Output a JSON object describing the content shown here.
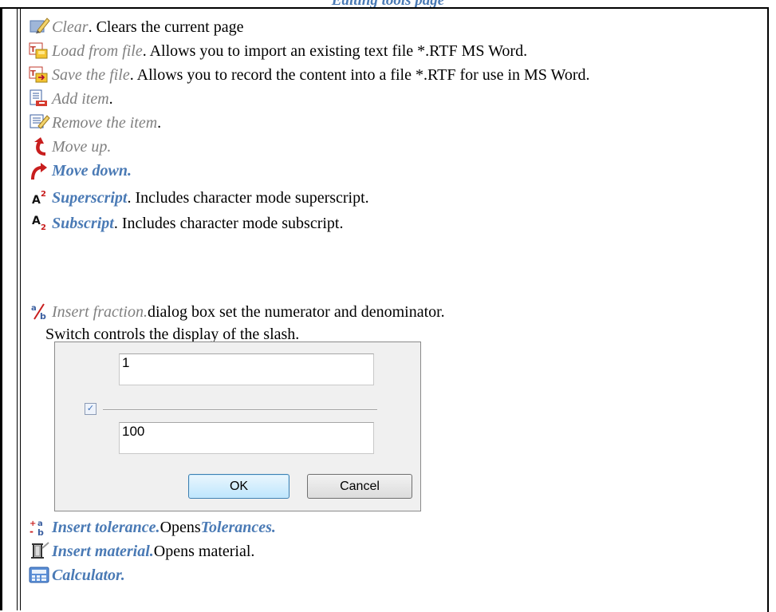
{
  "page": {
    "heading": "Editing tools page"
  },
  "items": [
    {
      "icon": "eraser-icon",
      "name": "Clear",
      "name_style": "gray",
      "text": ". Clears the current page"
    },
    {
      "icon": "load-file-icon",
      "name": "Load from file",
      "name_style": "gray",
      "text": ". Allows you to import an existing text file *.RTF MS Word."
    },
    {
      "icon": "save-file-icon",
      "name": "Save the file",
      "name_style": "gray",
      "text": ". Allows you to record the content into a file *.RTF for use in MS Word."
    },
    {
      "icon": "add-item-icon",
      "name": "Add item",
      "name_style": "gray",
      "text": "."
    },
    {
      "icon": "remove-item-icon",
      "name": "Remove the item",
      "name_style": "gray",
      "text": " ."
    },
    {
      "icon": "move-up-icon",
      "name": "Move up.",
      "name_style": "gray",
      "text": ""
    },
    {
      "icon": "move-down-icon",
      "name": "Move down.",
      "name_style": "blue",
      "text": ""
    },
    {
      "icon": "superscript-icon",
      "name": "Superscript",
      "name_style": "blue",
      "text": ". Includes character mode superscript."
    },
    {
      "icon": "subscript-icon",
      "name": "Subscript",
      "name_style": "blue",
      "text": ". Includes character mode subscript."
    },
    {
      "icon": "fraction-icon",
      "name": "Insert fraction.",
      "name_style": "gray",
      "text": " dialog box set the numerator and denominator."
    }
  ],
  "fraction_note": "Switch controls the display of the slash.",
  "dialog": {
    "numerator": "1",
    "denominator": "100",
    "slash_checked": true,
    "ok_label": "OK",
    "cancel_label": "Cancel"
  },
  "items_after": [
    {
      "icon": "tolerance-icon",
      "name": "Insert tolerance.",
      "name_style": "blue",
      "text": " Opens ",
      "link": "Tolerances."
    },
    {
      "icon": "material-icon",
      "name": "Insert material.",
      "name_style": "blue",
      "text": " Opens material."
    },
    {
      "icon": "calculator-icon",
      "name": "Calculator.",
      "name_style": "blue",
      "text": ""
    }
  ],
  "colors": {
    "accent": "#4a7ab5",
    "muted": "#808080"
  }
}
